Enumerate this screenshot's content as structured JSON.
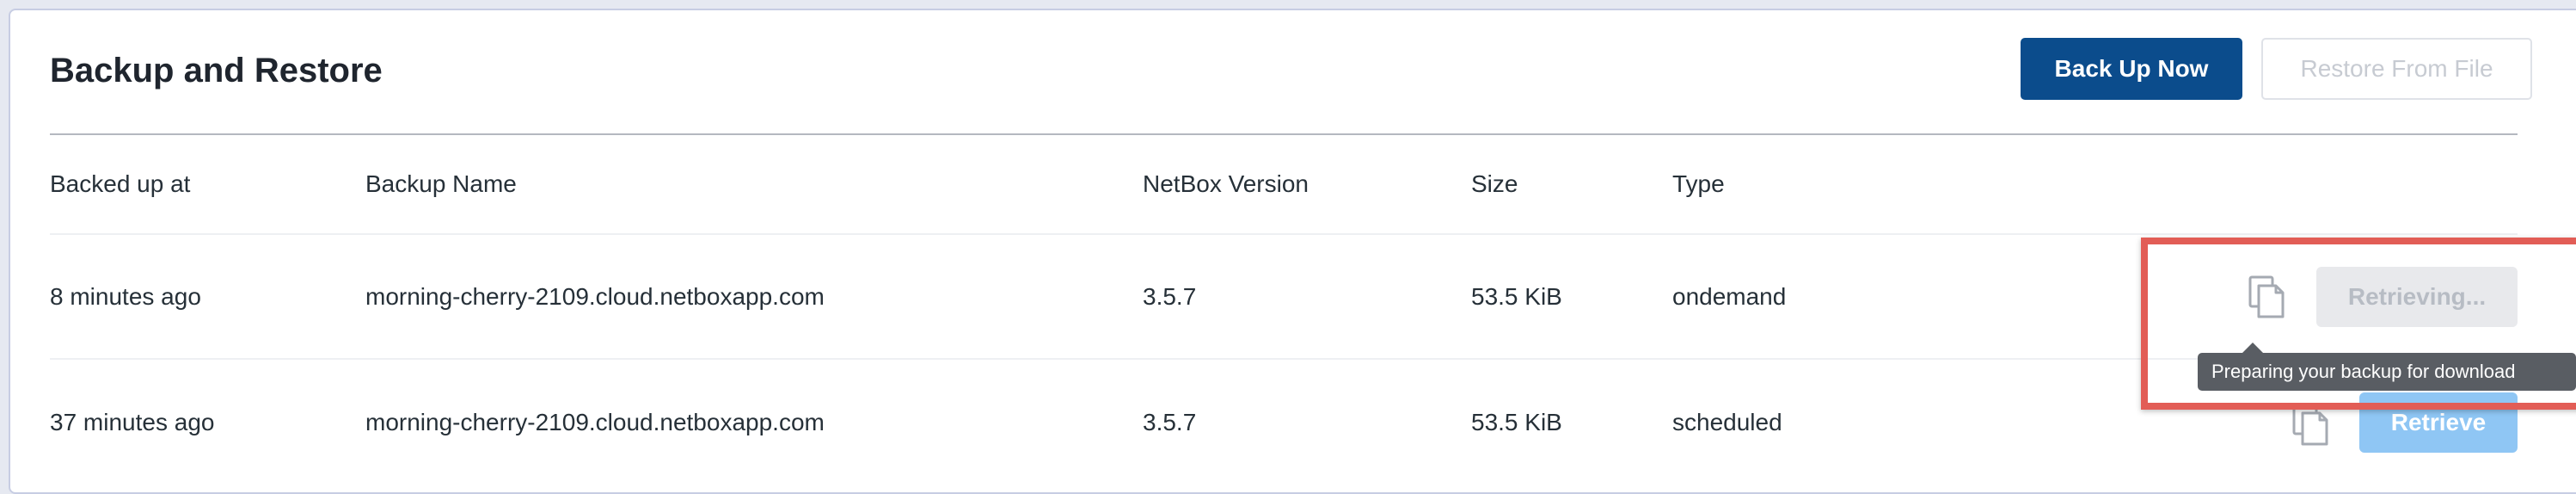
{
  "header": {
    "title": "Backup and Restore",
    "back_up_now_label": "Back Up Now",
    "restore_from_file_label": "Restore From File"
  },
  "table": {
    "columns": [
      "Backed up at",
      "Backup Name",
      "NetBox Version",
      "Size",
      "Type"
    ],
    "rows": [
      {
        "backed_up_at": "8 minutes ago",
        "backup_name": "morning-cherry-2109.cloud.netboxapp.com",
        "netbox_version": "3.5.7",
        "size": "53.5 KiB",
        "type": "ondemand",
        "action_label": "Retrieving...",
        "copy_icon": "copy-icon"
      },
      {
        "backed_up_at": "37 minutes ago",
        "backup_name": "morning-cherry-2109.cloud.netboxapp.com",
        "netbox_version": "3.5.7",
        "size": "53.5 KiB",
        "type": "scheduled",
        "action_label": "Retrieve",
        "copy_icon": "copy-icon"
      }
    ]
  },
  "tooltip": {
    "text": "Preparing your backup for download"
  },
  "colors": {
    "primary": "#0b4c8c",
    "retrieve_button": "#8fc6f4",
    "highlight": "#e25d56"
  }
}
